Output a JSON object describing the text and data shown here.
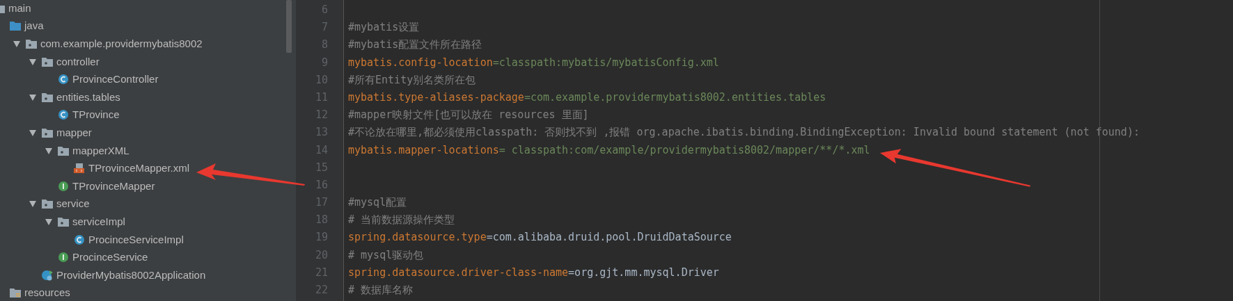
{
  "project_tree": [
    {
      "kind": "folder",
      "label": "main",
      "children": [
        {
          "kind": "source-folder",
          "label": "java",
          "children": [
            {
              "kind": "package",
              "label": "com.example.providermybatis8002",
              "expanded": true,
              "children": [
                {
                  "kind": "package",
                  "label": "controller",
                  "expanded": true,
                  "children": [
                    {
                      "kind": "class",
                      "label": "ProvinceController"
                    }
                  ]
                },
                {
                  "kind": "package",
                  "label": "entities.tables",
                  "expanded": true,
                  "children": [
                    {
                      "kind": "class",
                      "label": "TProvince"
                    }
                  ]
                },
                {
                  "kind": "package",
                  "label": "mapper",
                  "expanded": true,
                  "children": [
                    {
                      "kind": "package",
                      "label": "mapperXML",
                      "expanded": true,
                      "children": [
                        {
                          "kind": "xml",
                          "label": "TProvinceMapper.xml"
                        }
                      ]
                    },
                    {
                      "kind": "interface",
                      "label": "TProvinceMapper"
                    }
                  ]
                },
                {
                  "kind": "package",
                  "label": "service",
                  "expanded": true,
                  "children": [
                    {
                      "kind": "package",
                      "label": "serviceImpl",
                      "expanded": true,
                      "children": [
                        {
                          "kind": "class",
                          "label": "ProcinceServiceImpl"
                        }
                      ]
                    },
                    {
                      "kind": "interface",
                      "label": "ProcinceService"
                    }
                  ]
                },
                {
                  "kind": "spring-app",
                  "label": "ProviderMybatis8002Application"
                }
              ]
            }
          ]
        },
        {
          "kind": "resources-folder",
          "label": "resources"
        }
      ]
    }
  ],
  "editor": {
    "lines": [
      {
        "number": "6"
      },
      {
        "number": "7",
        "parts": [
          {
            "kind": "comment",
            "text": "#mybatis设置"
          }
        ]
      },
      {
        "number": "8",
        "parts": [
          {
            "kind": "comment",
            "text": "#mybatis配置文件所在路径"
          }
        ]
      },
      {
        "number": "9",
        "parts": [
          {
            "kind": "key",
            "text": "mybatis.config-location"
          },
          {
            "kind": "string",
            "text": "=classpath:mybatis/mybatisConfig.xml"
          }
        ]
      },
      {
        "number": "10",
        "parts": [
          {
            "kind": "comment",
            "text": "#所有Entity别名类所在包"
          }
        ]
      },
      {
        "number": "11",
        "parts": [
          {
            "kind": "key",
            "text": "mybatis.type-aliases-package"
          },
          {
            "kind": "string",
            "text": "=com.example.providermybatis8002.entities.tables"
          }
        ]
      },
      {
        "number": "12",
        "parts": [
          {
            "kind": "comment",
            "text": "#mapper映射文件[也可以放在 resources 里面]"
          }
        ]
      },
      {
        "number": "13",
        "parts": [
          {
            "kind": "comment",
            "text": "#不论放在哪里,都必须使用classpath: 否则找不到 ,报错 org.apache.ibatis.binding.BindingException: Invalid bound statement (not found):"
          }
        ]
      },
      {
        "number": "14",
        "parts": [
          {
            "kind": "key",
            "text": "mybatis.mapper-locations"
          },
          {
            "kind": "string",
            "text": "= classpath:com/example/providermybatis8002/mapper/**/*.xml"
          }
        ]
      },
      {
        "number": "15"
      },
      {
        "number": "16"
      },
      {
        "number": "17",
        "parts": [
          {
            "kind": "comment",
            "text": "#mysql配置"
          }
        ]
      },
      {
        "number": "18",
        "parts": [
          {
            "kind": "comment",
            "text": "# 当前数据源操作类型"
          }
        ]
      },
      {
        "number": "19",
        "parts": [
          {
            "kind": "key",
            "text": "spring.datasource.type"
          },
          {
            "kind": "plain",
            "text": "=com.alibaba.druid.pool.DruidDataSource"
          }
        ]
      },
      {
        "number": "20",
        "parts": [
          {
            "kind": "comment",
            "text": "# mysql驱动包"
          }
        ]
      },
      {
        "number": "21",
        "parts": [
          {
            "kind": "key",
            "text": "spring.datasource.driver-class-name"
          },
          {
            "kind": "plain",
            "text": "=org.gjt.mm.mysql.Driver"
          }
        ]
      },
      {
        "number": "22",
        "parts": [
          {
            "kind": "comment",
            "text": "# 数据库名称"
          }
        ]
      }
    ]
  }
}
